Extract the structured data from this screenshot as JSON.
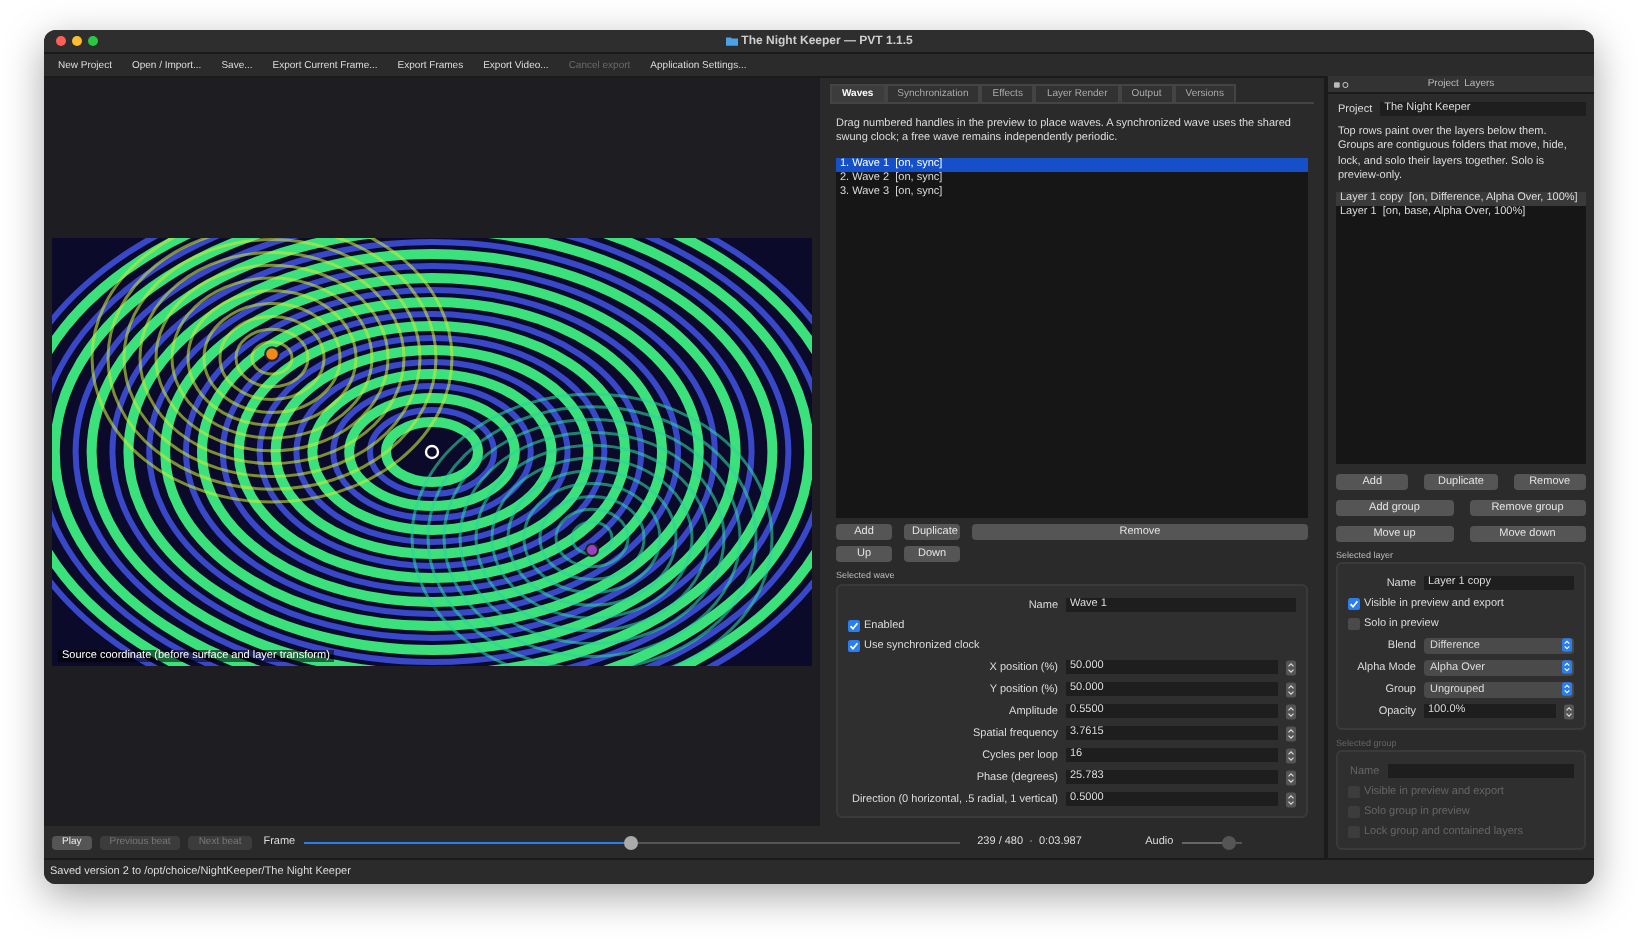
{
  "window": {
    "title": "The Night Keeper — PVT 1.1.5"
  },
  "toolbar": [
    {
      "label": "New Project",
      "disabled": false
    },
    {
      "label": "Open / Import...",
      "disabled": false
    },
    {
      "label": "Save...",
      "disabled": false
    },
    {
      "label": "Export Current Frame...",
      "disabled": false
    },
    {
      "label": "Export Frames",
      "disabled": false
    },
    {
      "label": "Export Video...",
      "disabled": false
    },
    {
      "label": "Cancel export",
      "disabled": true
    },
    {
      "label": "Application Settings...",
      "disabled": false
    }
  ],
  "preview": {
    "caption": "Source coordinate (before surface and layer transform)"
  },
  "tabs": [
    {
      "label": "Waves",
      "selected": true
    },
    {
      "label": "Synchronization",
      "selected": false
    },
    {
      "label": "Effects",
      "selected": false
    },
    {
      "label": "Layer Render",
      "selected": false
    },
    {
      "label": "Output",
      "selected": false
    },
    {
      "label": "Versions",
      "selected": false
    }
  ],
  "waves_panel": {
    "description": "Drag numbered handles in the preview to place waves. A synchronized wave uses the shared swung clock; a free wave remains independently periodic.",
    "waves": [
      {
        "label": "1. Wave 1  [on, sync]",
        "selected": true
      },
      {
        "label": "2. Wave 2  [on, sync]",
        "selected": false
      },
      {
        "label": "3. Wave 3  [on, sync]",
        "selected": false
      }
    ],
    "buttons": [
      "Add",
      "Duplicate",
      "Remove"
    ],
    "buttons_2": [
      "Up",
      "Down"
    ],
    "selected_wave": {
      "title": "Selected wave",
      "name": {
        "label": "Name",
        "value": "Wave 1"
      },
      "checkboxes": [
        {
          "label": "Enabled",
          "checked": true
        },
        {
          "label": "Use synchronized clock",
          "checked": true
        }
      ],
      "fields": [
        {
          "label": "X position (%)",
          "value": "50.000"
        },
        {
          "label": "Y position (%)",
          "value": "50.000"
        },
        {
          "label": "Amplitude",
          "value": "0.5500"
        },
        {
          "label": "Spatial frequency",
          "value": "3.7615"
        },
        {
          "label": "Cycles per loop",
          "value": "16"
        },
        {
          "label": "Phase (degrees)",
          "value": "25.783"
        },
        {
          "label": "Direction (0 horizontal, .5 radial, 1 vertical)",
          "value": "0.5000"
        }
      ]
    }
  },
  "layers_panel": {
    "title": "Project  Layers",
    "project": {
      "label": "Project",
      "value": "The Night Keeper"
    },
    "description": "Top rows paint over the layers below them. Groups are contiguous folders that move, hide, lock, and solo their layers together. Solo is preview-only.",
    "layers": [
      {
        "label": "Layer 1 copy  [on, Difference, Alpha Over, 100%]",
        "selected": true
      },
      {
        "label": "Layer 1  [on, base, Alpha Over, 100%]",
        "selected": false
      }
    ],
    "button_rows": [
      [
        "Add",
        "Duplicate",
        "Remove"
      ],
      [
        "Add group",
        "Remove group"
      ],
      [
        "Move up",
        "Move down"
      ]
    ],
    "selected_layer": {
      "title": "Selected layer",
      "name": {
        "label": "Name",
        "value": "Layer 1 copy"
      },
      "checkboxes": [
        {
          "label": "Visible in preview and export",
          "checked": true
        },
        {
          "label": "Solo in preview",
          "checked": false
        }
      ],
      "selects": [
        {
          "label": "Blend",
          "value": "Difference"
        },
        {
          "label": "Alpha Mode",
          "value": "Alpha Over"
        },
        {
          "label": "Group",
          "value": "Ungrouped"
        }
      ],
      "opacity": {
        "label": "Opacity",
        "value": "100.0%"
      }
    },
    "selected_group": {
      "title": "Selected group",
      "disabled": true,
      "name_label": "Name",
      "checkboxes": [
        {
          "label": "Visible in preview and export",
          "checked": false
        },
        {
          "label": "Solo group in preview",
          "checked": false
        },
        {
          "label": "Lock group and contained layers",
          "checked": false
        }
      ]
    }
  },
  "transport": {
    "buttons": [
      {
        "label": "Play",
        "disabled": false
      },
      {
        "label": "Previous beat",
        "disabled": true
      },
      {
        "label": "Next beat",
        "disabled": true
      }
    ],
    "frame_label": "Frame",
    "frame": {
      "level": 0.5
    },
    "reading": "239 / 480  ·  0:03.987",
    "audio_label": "Audio",
    "audio": {
      "level": 0.8
    }
  },
  "status_bar": "Saved version 2 to /opt/choice/NightKeeper/The Night Keeper"
}
